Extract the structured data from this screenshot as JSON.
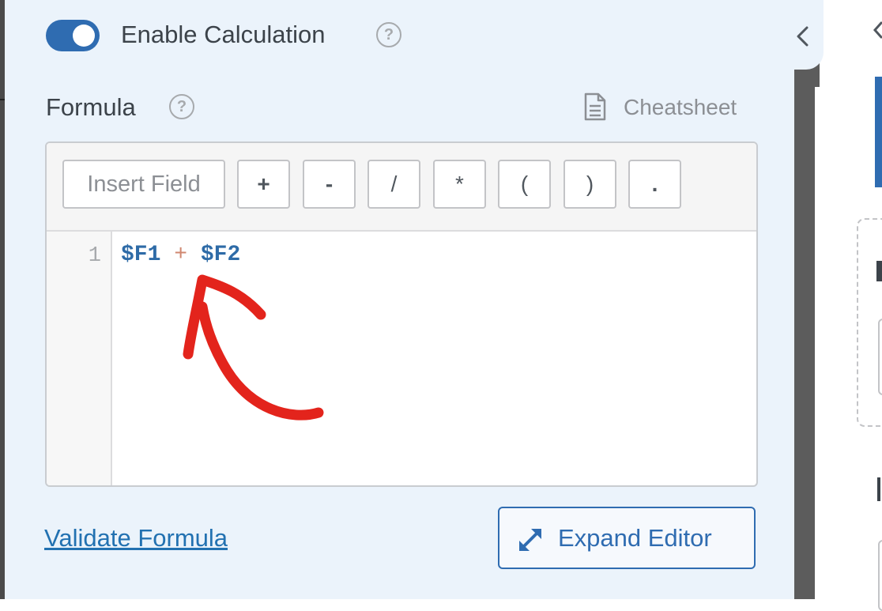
{
  "calculation": {
    "toggle_enabled": true,
    "label": "Enable Calculation",
    "help_icon": "question-circle-icon"
  },
  "formula": {
    "label": "Formula",
    "help_icon": "question-circle-icon",
    "cheatsheet_label": "Cheatsheet",
    "cheatsheet_icon": "document-icon"
  },
  "toolbar": {
    "insert_field_placeholder": "Insert Field",
    "operators": [
      "+",
      "-",
      "/",
      "*",
      "(",
      ")",
      "."
    ]
  },
  "editor": {
    "line_number": "1",
    "code_tokens": [
      "$F1",
      "+",
      "$F2"
    ],
    "annotation_icon": "red-hand-drawn-arrow-icon"
  },
  "actions": {
    "validate_label": "Validate Formula",
    "expand_label": "Expand Editor",
    "expand_icon": "expand-arrows-icon"
  },
  "colors": {
    "accent": "#2f6cb1",
    "panel_bg": "#ebf3fb",
    "operator": "#d08770",
    "field_token": "#2e6ba7",
    "annotation": "#e3241c"
  }
}
